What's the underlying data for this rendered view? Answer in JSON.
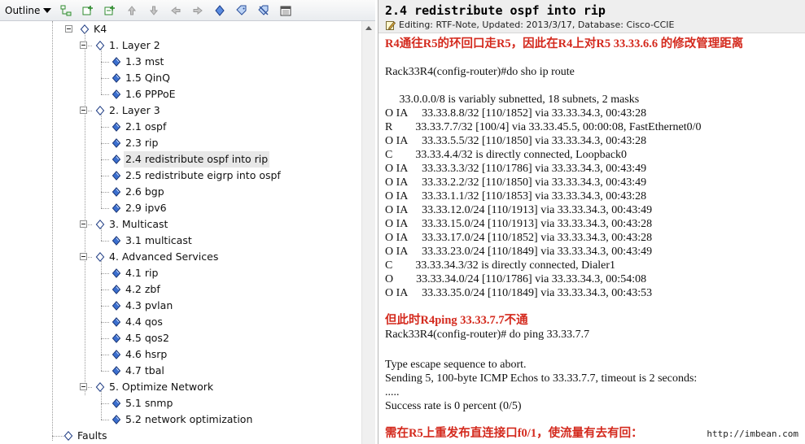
{
  "toolbar": {
    "label": "Outline",
    "buttons": [
      "add-sibling-icon",
      "add-child-icon",
      "add-child-alt-icon",
      "move-up-icon",
      "move-down-icon",
      "move-left-icon",
      "move-right-icon",
      "node-icon",
      "tag-icon",
      "remove-tag-icon",
      "calendar-icon"
    ]
  },
  "tree": {
    "root": "K4",
    "items": [
      {
        "label": "1. Layer 2"
      },
      {
        "label": "1.3 mst"
      },
      {
        "label": "1.5 QinQ"
      },
      {
        "label": "1.6 PPPoE"
      },
      {
        "label": "2. Layer 3"
      },
      {
        "label": "2.1 ospf"
      },
      {
        "label": "2.3 rip"
      },
      {
        "label": "2.4 redistribute ospf into rip"
      },
      {
        "label": "2.5 redistribute eigrp into ospf"
      },
      {
        "label": "2.6 bgp"
      },
      {
        "label": "2.9 ipv6"
      },
      {
        "label": "3. Multicast"
      },
      {
        "label": "3.1 multicast"
      },
      {
        "label": "4. Advanced Services"
      },
      {
        "label": "4.1 rip"
      },
      {
        "label": "4.2 zbf"
      },
      {
        "label": "4.3 pvlan"
      },
      {
        "label": "4.4 qos"
      },
      {
        "label": "4.5 qos2"
      },
      {
        "label": "4.6 hsrp"
      },
      {
        "label": "4.7 tbal"
      },
      {
        "label": "5. Optimize Network"
      },
      {
        "label": "5.1 snmp"
      },
      {
        "label": "5.2 network optimization"
      }
    ],
    "sibling": "Faults",
    "selected": "2.4 redistribute ospf into rip"
  },
  "note": {
    "title": "2.4 redistribute ospf into rip",
    "editing": "Editing: RTF-Note, Updated: 2013/3/17, Database: Cisco-CCIE",
    "lines": [
      "R4通往R5的环回口走R5，因此在R4上对R5 33.33.6.6 的修改管理距离",
      "",
      "Rack33R4(config-router)#do sho ip route",
      "",
      "     33.0.0.0/8 is variably subnetted, 18 subnets, 2 masks",
      "O IA     33.33.8.8/32 [110/1852] via 33.33.34.3, 00:43:28",
      "R        33.33.7.7/32 [100/4] via 33.33.45.5, 00:00:08, FastEthernet0/0",
      "O IA     33.33.5.5/32 [110/1850] via 33.33.34.3, 00:43:28",
      "C        33.33.4.4/32 is directly connected, Loopback0",
      "O IA     33.33.3.3/32 [110/1786] via 33.33.34.3, 00:43:49",
      "O IA     33.33.2.2/32 [110/1850] via 33.33.34.3, 00:43:49",
      "O IA     33.33.1.1/32 [110/1853] via 33.33.34.3, 00:43:28",
      "O IA     33.33.12.0/24 [110/1913] via 33.33.34.3, 00:43:49",
      "O IA     33.33.15.0/24 [110/1913] via 33.33.34.3, 00:43:28",
      "O IA     33.33.17.0/24 [110/1852] via 33.33.34.3, 00:43:28",
      "O IA     33.33.23.0/24 [110/1849] via 33.33.34.3, 00:43:49",
      "C        33.33.34.3/32 is directly connected, Dialer1",
      "O        33.33.34.0/24 [110/1786] via 33.33.34.3, 00:54:08",
      "O IA     33.33.35.0/24 [110/1849] via 33.33.34.3, 00:43:53",
      "",
      "但此时R4ping 33.33.7.7不通",
      "Rack33R4(config-router)# do ping 33.33.7.7",
      "",
      "Type escape sequence to abort.",
      "Sending 5, 100-byte ICMP Echos to 33.33.7.7, timeout is 2 seconds:",
      ".....",
      "Success rate is 0 percent (0/5)",
      "",
      "需在R5上重发布直连接口f0/1，使流量有去有回："
    ],
    "red_lines": [
      0,
      20,
      28
    ]
  },
  "watermark": "http://imbean.com",
  "colors": {
    "accent_red": "#d42a1e",
    "header_bg": "#eeeeee",
    "node_fill": "#3b6fcf"
  }
}
